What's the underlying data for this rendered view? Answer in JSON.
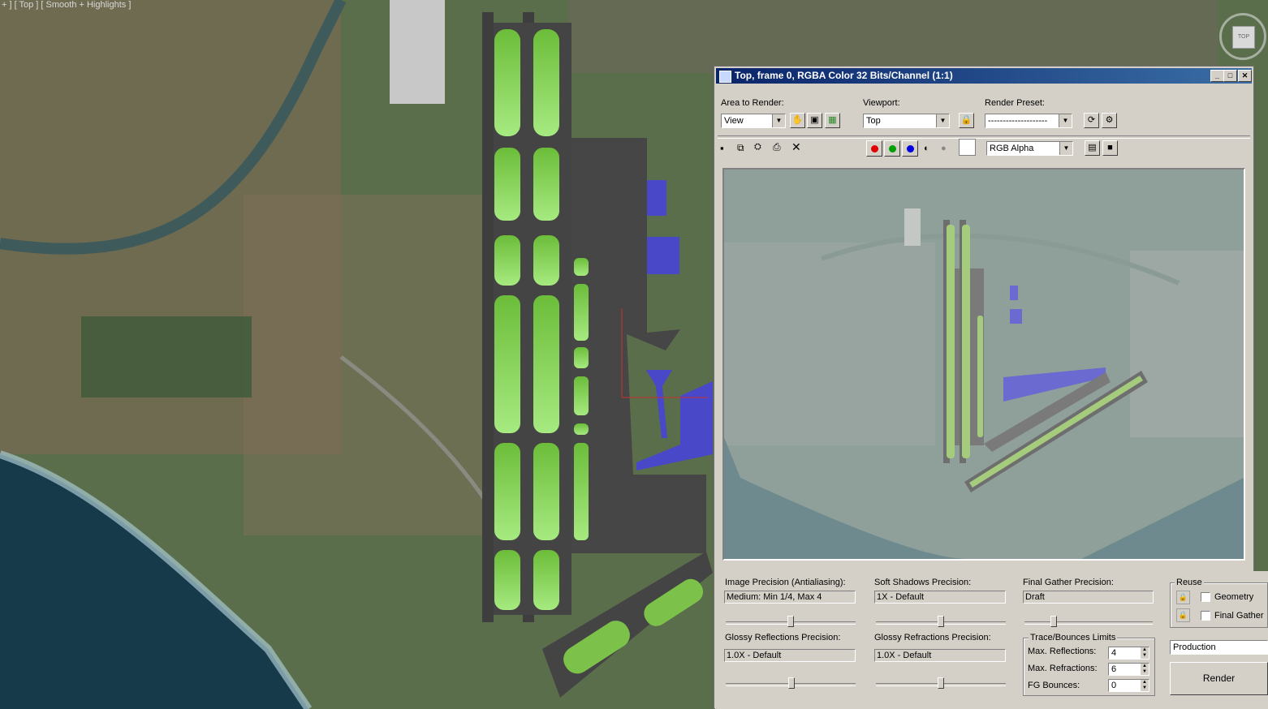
{
  "viewport": {
    "label": "+ ] [ Top ] [ Smooth + Highlights ]",
    "viewcube_face": "TOP",
    "colors": {
      "runway": "#444444",
      "grass": "#7cc24a",
      "terminal": "#4848c8",
      "sea": "#163a4a"
    }
  },
  "window": {
    "title": "Top, frame 0, RGBA Color 32 Bits/Channel (1:1)",
    "buttons": {
      "minimize": "_",
      "maximize": "□",
      "close": "✕"
    }
  },
  "toolbar": {
    "area_label": "Area to Render:",
    "area_value": "View",
    "viewport_label": "Viewport:",
    "viewport_value": "Top",
    "preset_label": "Render Preset:",
    "preset_value": "--------------------",
    "channel_value": "RGB Alpha",
    "channel_colors": {
      "red": "#e00000",
      "green": "#00a000",
      "blue": "#0000e0"
    }
  },
  "settings": {
    "image_precision_label": "Image Precision (Antialiasing):",
    "image_precision_value": "Medium: Min 1/4, Max 4",
    "soft_shadows_label": "Soft Shadows Precision:",
    "soft_shadows_value": "1X - Default",
    "final_gather_label": "Final Gather Precision:",
    "final_gather_value": "Draft",
    "glossy_reflections_label": "Glossy Reflections Precision:",
    "glossy_reflections_value": "1.0X - Default",
    "glossy_refractions_label": "Glossy Refractions Precision:",
    "glossy_refractions_value": "1.0X - Default",
    "trace_group_label": "Trace/Bounces Limits",
    "max_reflections_label": "Max. Reflections:",
    "max_reflections_value": "4",
    "max_refractions_label": "Max. Refractions:",
    "max_refractions_value": "6",
    "fg_bounces_label": "FG Bounces:",
    "fg_bounces_value": "0",
    "reuse_label": "Reuse",
    "geometry_label": "Geometry",
    "final_gather_reuse_label": "Final Gather",
    "mode_value": "Production",
    "render_label": "Render"
  }
}
